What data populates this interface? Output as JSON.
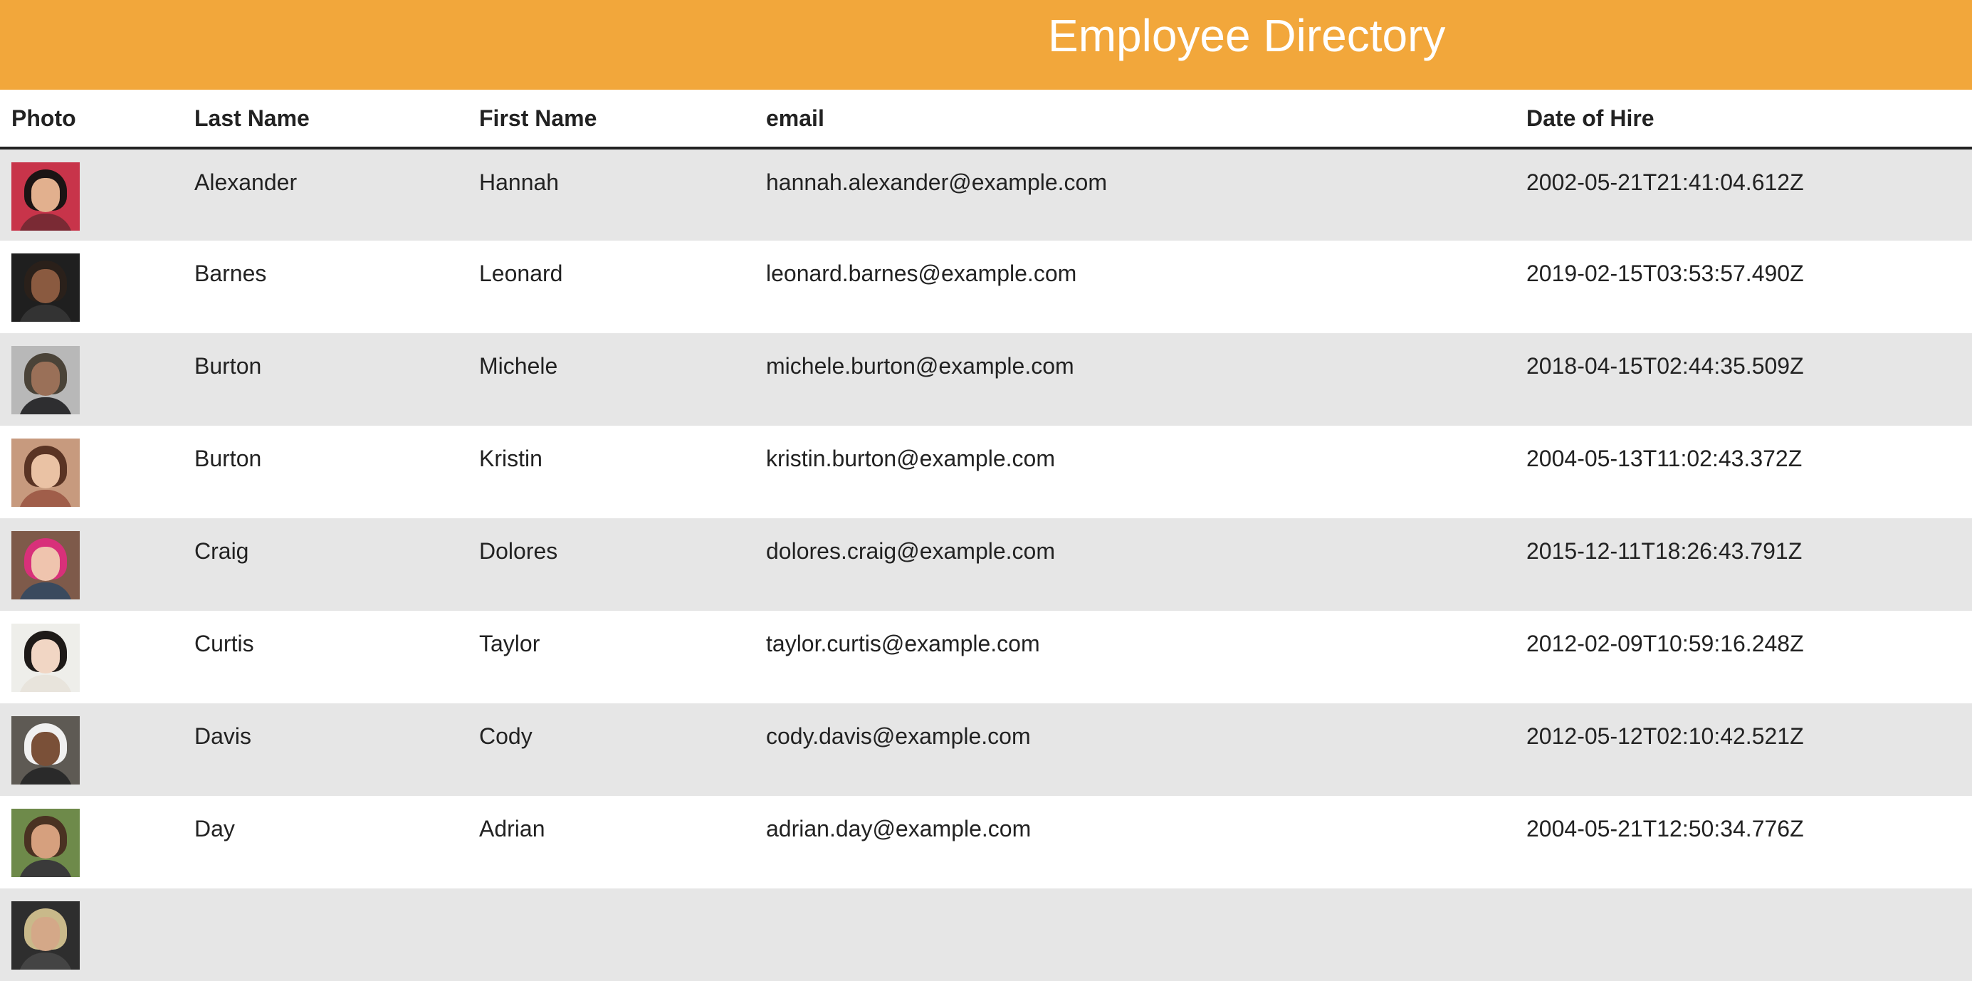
{
  "header": {
    "title": "Employee Directory"
  },
  "table": {
    "columns": [
      "Photo",
      "Last Name",
      "First Name",
      "email",
      "Date of Hire"
    ],
    "rows": [
      {
        "last": "Alexander",
        "first": "Hannah",
        "email": "hannah.alexander@example.com",
        "hired": "2002-05-21T21:41:04.612Z",
        "photo": "avatar-photo"
      },
      {
        "last": "Barnes",
        "first": "Leonard",
        "email": "leonard.barnes@example.com",
        "hired": "2019-02-15T03:53:57.490Z",
        "photo": "avatar-photo"
      },
      {
        "last": "Burton",
        "first": "Michele",
        "email": "michele.burton@example.com",
        "hired": "2018-04-15T02:44:35.509Z",
        "photo": "avatar-photo"
      },
      {
        "last": "Burton",
        "first": "Kristin",
        "email": "kristin.burton@example.com",
        "hired": "2004-05-13T11:02:43.372Z",
        "photo": "avatar-photo"
      },
      {
        "last": "Craig",
        "first": "Dolores",
        "email": "dolores.craig@example.com",
        "hired": "2015-12-11T18:26:43.791Z",
        "photo": "avatar-photo"
      },
      {
        "last": "Curtis",
        "first": "Taylor",
        "email": "taylor.curtis@example.com",
        "hired": "2012-02-09T10:59:16.248Z",
        "photo": "avatar-photo"
      },
      {
        "last": "Davis",
        "first": "Cody",
        "email": "cody.davis@example.com",
        "hired": "2012-05-12T02:10:42.521Z",
        "photo": "avatar-photo"
      },
      {
        "last": "Day",
        "first": "Adrian",
        "email": "adrian.day@example.com",
        "hired": "2004-05-21T12:50:34.776Z",
        "photo": "avatar-photo"
      }
    ]
  },
  "colors": {
    "header_bg": "#f2a73b",
    "header_text": "#ffffff",
    "row_alt": "#e6e6e6"
  }
}
